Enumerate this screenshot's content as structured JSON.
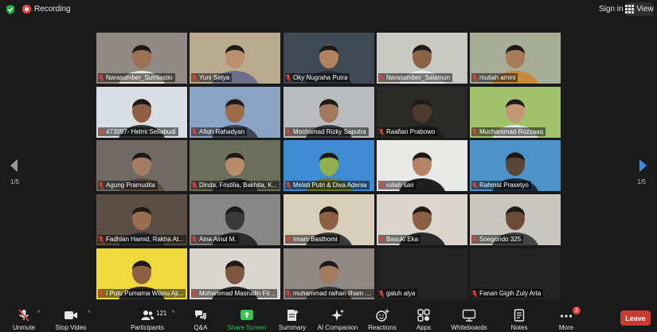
{
  "header": {
    "recording_label": "Recording",
    "sign_in_label": "Sign in",
    "view_label": "View"
  },
  "navigation": {
    "left_page": "1/5",
    "right_page": "1/5"
  },
  "participants": [
    {
      "name": "Narasumber_Sutrilastio",
      "bg": "#8f8a84",
      "skin": "#9d7155",
      "shirt": "#eae4d6"
    },
    {
      "name": "Yuni Setya",
      "bg": "#b8a98f",
      "skin": "#b98f6e",
      "shirt": "#6d6f88"
    },
    {
      "name": "Oky Nugraha Putra",
      "bg": "#3f4a55",
      "skin": "#b2825e",
      "shirt": "#2b2f36"
    },
    {
      "name": "Narasumber_Salamun",
      "bg": "#c9c9c4",
      "skin": "#8c6247",
      "shirt": "#eeeeee"
    },
    {
      "name": "mutiah amini",
      "bg": "#a6ad94",
      "skin": "#a97a5a",
      "shirt": "#c8893a"
    },
    {
      "name": "473097- Helmi Setiabudi",
      "bg": "#d9dee2",
      "skin": "#8e5f44",
      "shirt": "#323436"
    },
    {
      "name": "Afiqh Rahadyan",
      "bg": "#8aa3c4",
      "skin": "#9b6b4c",
      "shirt": "#3e4456"
    },
    {
      "name": "Mochamad Rizky Saputra",
      "bg": "#b8bcbf",
      "skin": "#a1785d",
      "shirt": "#3a3e42"
    },
    {
      "name": "Raafian Prabowo",
      "bg": "#2a2a28",
      "skin": "#4d3a2c",
      "shirt": "#1f1f1f"
    },
    {
      "name": "Muchammad Rozzaaq",
      "bg": "#9fc26b",
      "skin": "#c59675",
      "shirt": "#e8e8e8"
    },
    {
      "name": "Agung Pramudita",
      "bg": "#706a66",
      "skin": "#a57d65",
      "shirt": "#5a4a40"
    },
    {
      "name": "Dinda, Fristilia, Bakhita, K...",
      "bg": "#6b6e58",
      "skin": "#b88c6a",
      "shirt": "#2a2a2a"
    },
    {
      "name": "Melati Putri & Diva Adenia",
      "bg": "#3e8bd1",
      "skin": "#8fb04a",
      "shirt": "#6a7a2c"
    },
    {
      "name": "ruliah sari",
      "bg": "#e8e8e6",
      "skin": "#b58467",
      "shirt": "#1f1f1f"
    },
    {
      "name": "Rahmat Prasetyo",
      "bg": "#4d93c9",
      "skin": "#5a4636",
      "shirt": "#1f2a3a"
    },
    {
      "name": "Fadhlan Hamid, Rakha At...",
      "bg": "#5a4e45",
      "skin": "#9a6e50",
      "shirt": "#2a2e33"
    },
    {
      "name": "Aina Ainul M.",
      "bg": "#878787",
      "skin": "#3a3a3a",
      "shirt": "#2a2a2a"
    },
    {
      "name": "Imam Basthomi",
      "bg": "#d7cfba",
      "skin": "#8c5f42",
      "shirt": "#3a3a3a"
    },
    {
      "name": "Basuki Eka",
      "bg": "#d9d4cc",
      "skin": "#8a5f45",
      "shirt": "#2a2a2a"
    },
    {
      "name": "Soegondo 325",
      "bg": "#c9c6bf",
      "skin": "#6b4c38",
      "shirt": "#444444"
    },
    {
      "name": "I Putu Purnama Wisnu Aji...",
      "bg": "#f2d93b",
      "skin": "#8e5f42",
      "shirt": "#2b2b2b"
    },
    {
      "name": "Mohammad Masrudin Fir...",
      "bg": "#d9d6d0",
      "skin": "#7a5540",
      "shirt": "#2a2a2a"
    },
    {
      "name": "muhammad raihan ilham s...",
      "bg": "#8e8982",
      "skin": "#a27a5e",
      "shirt": "#3a3a3a"
    },
    {
      "name": "galuh alya",
      "bg": "#232323",
      "skin": "",
      "shirt": ""
    },
    {
      "name": "Fanan Gigih Zuly Arta",
      "bg": "#232323",
      "skin": "",
      "shirt": ""
    }
  ],
  "toolbar": {
    "unmute": "Unmute",
    "stop_video": "Stop Video",
    "participants": "Participants",
    "participants_count": "121",
    "qa": "Q&A",
    "share_screen": "Share Screen",
    "summary": "Summary",
    "ai_companion": "AI Companion",
    "reactions": "Reactions",
    "apps": "Apps",
    "whiteboards": "Whiteboards",
    "notes": "Notes",
    "more": "More",
    "more_badge": "2",
    "leave": "Leave"
  },
  "colors": {
    "background": "#1a1a1a",
    "accent_green": "#33c24d",
    "leave_red": "#c93a31",
    "active_speaker_border": "#d6d76a",
    "muted_red": "#e0453a",
    "nav_arrow_blue": "#2f8fe6"
  },
  "icons": [
    "shield-icon",
    "record-icon",
    "grid-view-icon",
    "microphone-muted-icon",
    "video-camera-icon",
    "participants-icon",
    "qa-icon",
    "share-screen-icon",
    "summary-icon",
    "ai-sparkle-icon",
    "reactions-icon",
    "apps-icon",
    "whiteboard-icon",
    "notes-icon",
    "more-icon"
  ]
}
